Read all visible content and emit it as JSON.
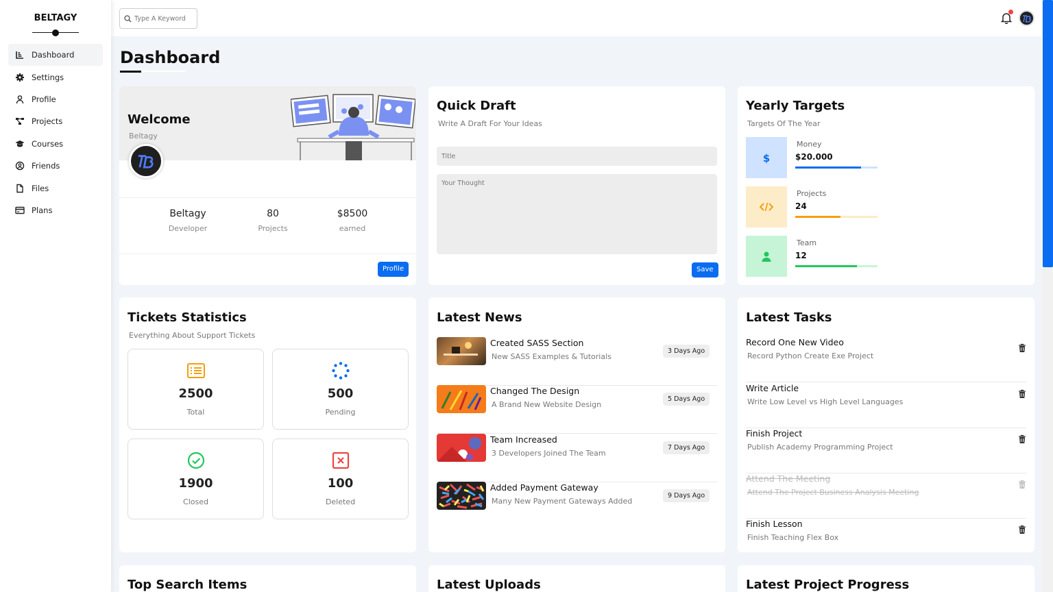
{
  "sidebar": {
    "logo": "BELTAGY",
    "items": [
      {
        "label": "Dashboard",
        "icon": "chart-line-icon"
      },
      {
        "label": "Settings",
        "icon": "gear-icon"
      },
      {
        "label": "Profile",
        "icon": "user-icon"
      },
      {
        "label": "Projects",
        "icon": "diagram-project-icon"
      },
      {
        "label": "Courses",
        "icon": "graduation-cap-icon"
      },
      {
        "label": "Friends",
        "icon": "circle-user-icon"
      },
      {
        "label": "Files",
        "icon": "file-icon"
      },
      {
        "label": "Plans",
        "icon": "credit-card-icon"
      }
    ]
  },
  "header": {
    "search_placeholder": "Type A Keyword"
  },
  "page": {
    "title": "Dashboard"
  },
  "welcome": {
    "title": "Welcome",
    "name": "Beltagy",
    "stats": [
      {
        "value": "Beltagy",
        "label": "Developer"
      },
      {
        "value": "80",
        "label": "Projects"
      },
      {
        "value": "$8500",
        "label": "earned"
      }
    ],
    "button": "Profile"
  },
  "draft": {
    "title": "Quick Draft",
    "subtitle": "Write A Draft For Your Ideas",
    "title_placeholder": "Title",
    "body_placeholder": "Your Thought",
    "button": "Save"
  },
  "targets": {
    "title": "Yearly Targets",
    "subtitle": "Targets Of The Year",
    "items": [
      {
        "label": "Money",
        "value": "$20.000",
        "progress": 0.8,
        "color": "#0a6cf0",
        "track": "#cfe2ff",
        "bg": "#cfe2ff",
        "icon": "dollar-icon"
      },
      {
        "label": "Projects",
        "value": "24",
        "progress": 0.55,
        "color": "#f59e0b",
        "track": "#fdecc8",
        "bg": "#fdecc8",
        "icon": "code-icon"
      },
      {
        "label": "Team",
        "value": "12",
        "progress": 0.75,
        "color": "#22c55e",
        "track": "#c6f4d6",
        "bg": "#c6f4d6",
        "icon": "user-icon"
      }
    ]
  },
  "tickets": {
    "title": "Tickets Statistics",
    "subtitle": "Everything About Support Tickets",
    "items": [
      {
        "value": "2500",
        "label": "Total"
      },
      {
        "value": "500",
        "label": "Pending"
      },
      {
        "value": "1900",
        "label": "Closed"
      },
      {
        "value": "100",
        "label": "Deleted"
      }
    ]
  },
  "news": {
    "title": "Latest News",
    "items": [
      {
        "title": "Created SASS Section",
        "subtitle": "New SASS Examples & Tutorials",
        "date": "3 Days Ago"
      },
      {
        "title": "Changed The Design",
        "subtitle": "A Brand New Website Design",
        "date": "5 Days Ago"
      },
      {
        "title": "Team Increased",
        "subtitle": "3 Developers Joined The Team",
        "date": "7 Days Ago"
      },
      {
        "title": "Added Payment Gateway",
        "subtitle": "Many New Payment Gateways Added",
        "date": "9 Days Ago"
      }
    ]
  },
  "tasks": {
    "title": "Latest Tasks",
    "items": [
      {
        "title": "Record One New Video",
        "subtitle": "Record Python Create Exe Project"
      },
      {
        "title": "Write Article",
        "subtitle": "Write Low Level vs High Level Languages"
      },
      {
        "title": "Finish Project",
        "subtitle": "Publish Academy Programming Project"
      },
      {
        "title": "Attend The Meeting",
        "subtitle": "Attend The Project Business Analysis Meeting"
      },
      {
        "title": "Finish Lesson",
        "subtitle": "Finish Teaching Flex Box"
      }
    ]
  },
  "bottom": {
    "search_items": "Top Search Items",
    "uploads": "Latest Uploads",
    "progress": "Latest Project Progress"
  }
}
